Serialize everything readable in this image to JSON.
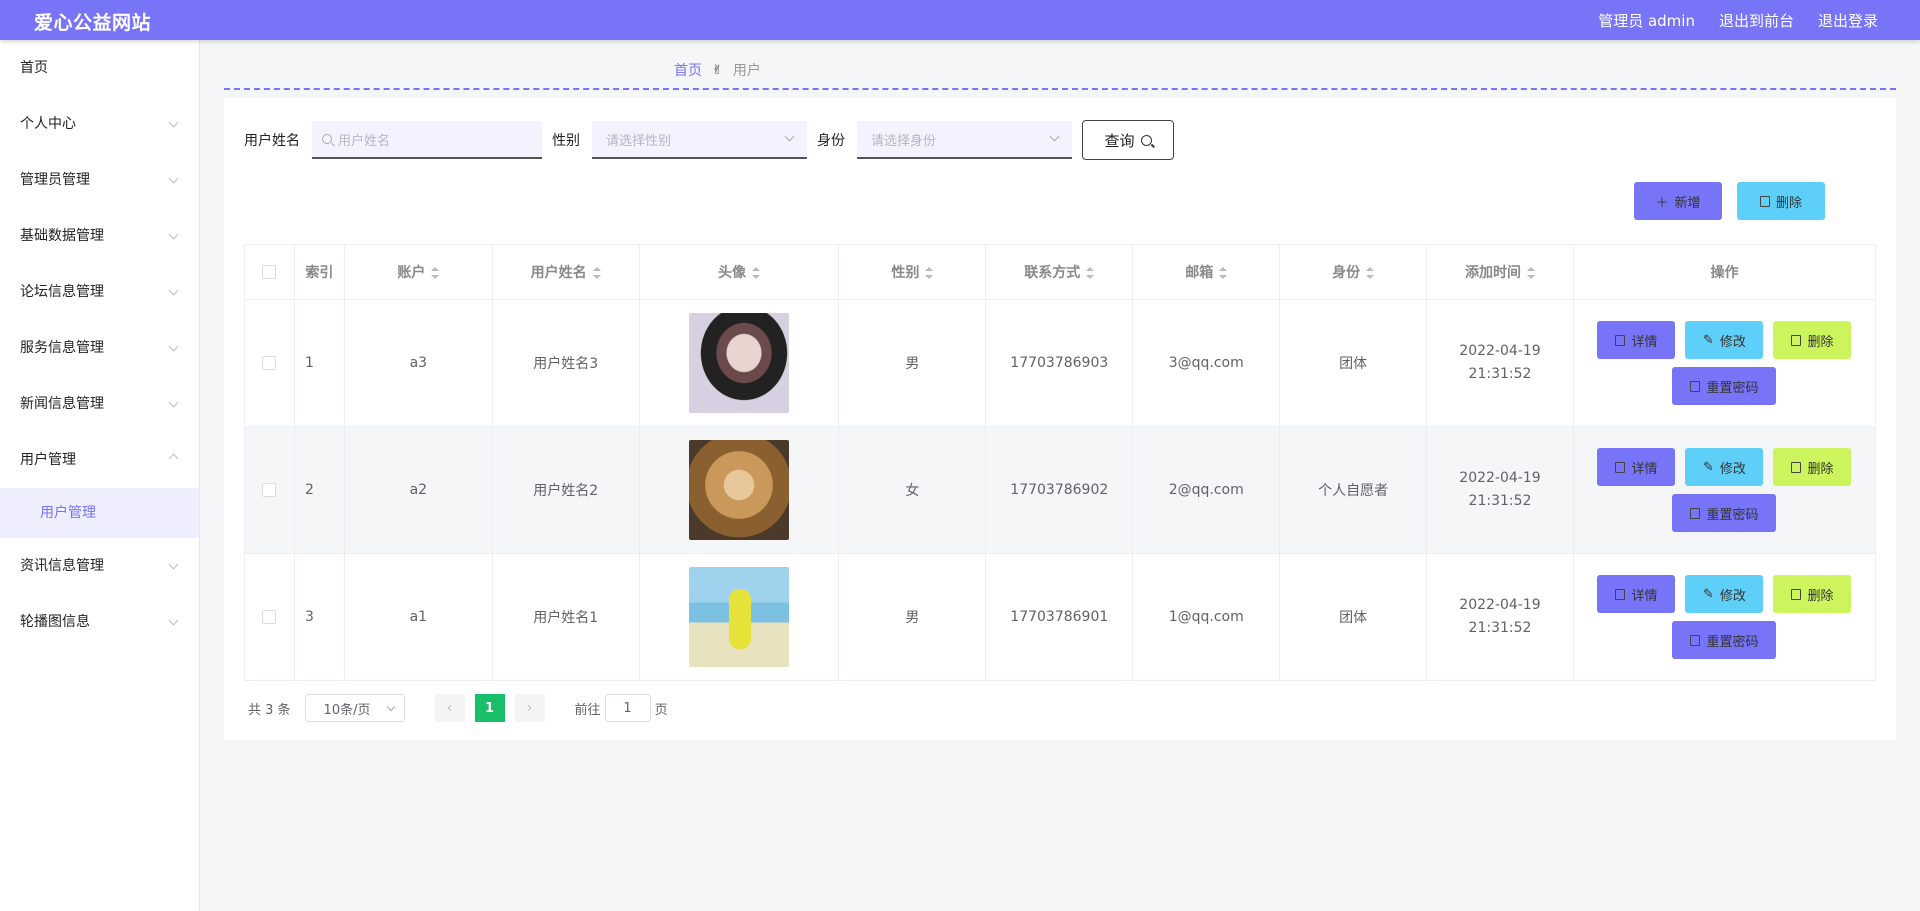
{
  "header": {
    "logo": "爱心公益网站",
    "admin_label": "管理员 admin",
    "to_front": "退出到前台",
    "logout": "退出登录",
    "color": "#7774f7"
  },
  "sidebar": {
    "items": [
      {
        "label": "首页",
        "chevron": "none"
      },
      {
        "label": "个人中心",
        "chevron": "down"
      },
      {
        "label": "管理员管理",
        "chevron": "down"
      },
      {
        "label": "基础数据管理",
        "chevron": "down"
      },
      {
        "label": "论坛信息管理",
        "chevron": "down"
      },
      {
        "label": "服务信息管理",
        "chevron": "down"
      },
      {
        "label": "新闻信息管理",
        "chevron": "down"
      },
      {
        "label": "用户管理",
        "chevron": "up"
      },
      {
        "label": "资讯信息管理",
        "chevron": "down"
      },
      {
        "label": "轮播图信息",
        "chevron": "down"
      }
    ],
    "sub_item": "用户管理"
  },
  "breadcrumb": {
    "home": "首页",
    "separator": "✌",
    "current": "用户"
  },
  "search": {
    "name_label": "用户姓名",
    "name_placeholder": "用户姓名",
    "gender_label": "性别",
    "gender_placeholder": "请选择性别",
    "role_label": "身份",
    "role_placeholder": "请选择身份",
    "query_button": "查询"
  },
  "actions": {
    "add": "新增",
    "delete": "删除"
  },
  "table": {
    "columns": [
      "索引",
      "账户",
      "用户姓名",
      "头像",
      "性别",
      "联系方式",
      "邮箱",
      "身份",
      "添加时间",
      "操作"
    ],
    "rows": [
      {
        "index": "1",
        "account": "a3",
        "name": "用户姓名3",
        "avatar": "photo-woman-portrait",
        "gender": "男",
        "phone": "17703786903",
        "email": "3@qq.com",
        "role": "团体",
        "time": "2022-04-19 21:31:52"
      },
      {
        "index": "2",
        "account": "a2",
        "name": "用户姓名2",
        "avatar": "photo-puppy",
        "gender": "女",
        "phone": "17703786902",
        "email": "2@qq.com",
        "role": "个人自愿者",
        "time": "2022-04-19 21:31:52"
      },
      {
        "index": "3",
        "account": "a1",
        "name": "用户姓名1",
        "avatar": "photo-girl-beach",
        "gender": "男",
        "phone": "17703786901",
        "email": "1@qq.com",
        "role": "团体",
        "time": "2022-04-19 21:31:52"
      }
    ],
    "ops": {
      "detail": "详情",
      "edit": "修改",
      "delete": "删除",
      "reset": "重置密码"
    }
  },
  "pagination": {
    "total": "共 3 条",
    "page_size": "10条/页",
    "current_page": "1",
    "goto_label": "前往",
    "goto_value": "1",
    "page_suffix": "页"
  },
  "colors": {
    "primary": "#7774f7",
    "info": "#5ecff9",
    "warn": "#ccf55d",
    "page_active": "#19be6b"
  }
}
